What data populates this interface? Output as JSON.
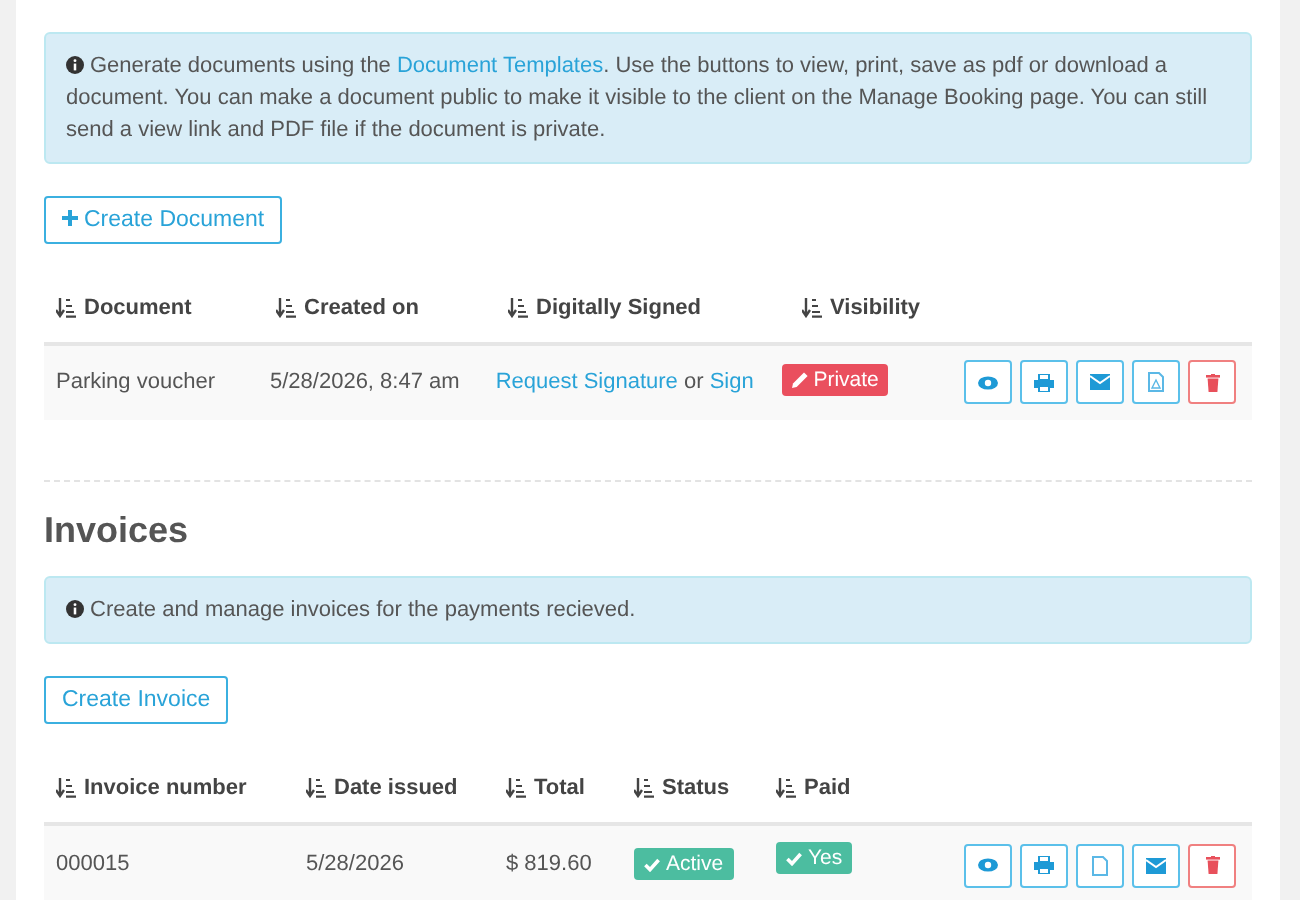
{
  "documents": {
    "info": {
      "before": "Generate documents using the ",
      "link": "Document Templates",
      "after": ". Use the buttons to view, print, save as pdf or download a document. You can make a document public to make it visible to the client on the Manage Booking page. You can still send a view link and PDF file if the document is private."
    },
    "create_button": "Create Document",
    "columns": [
      "Document",
      "Created on",
      "Digitally Signed",
      "Visibility"
    ],
    "rows": [
      {
        "cells": [
          "Parking voucher",
          "5/28/2026, 8:47 am"
        ],
        "signed": {
          "link": "Request Signature",
          "separator": "or",
          "second_link": "Sign"
        },
        "badge": {
          "label": "Private",
          "kind": "private"
        },
        "actions": [
          {
            "kind": "view"
          },
          {
            "kind": "print"
          },
          {
            "kind": "email"
          },
          {
            "kind": "pdf"
          },
          {
            "kind": "delete"
          }
        ]
      }
    ]
  },
  "invoices": {
    "heading": "Invoices",
    "info": "Create and manage invoices for the payments recieved.",
    "create_button": "Create Invoice",
    "columns": [
      "Invoice number",
      "Date issued",
      "Total",
      "Status",
      "Paid"
    ],
    "rows": [
      {
        "cells": [
          "000015",
          "5/28/2026",
          "$ 819.60"
        ],
        "status": {
          "label": "Active",
          "kind": "active"
        },
        "paid": {
          "label": "Yes",
          "kind": "yes"
        },
        "actions": [
          {
            "kind": "view"
          },
          {
            "kind": "print"
          },
          {
            "kind": "file"
          },
          {
            "kind": "email"
          },
          {
            "kind": "delete"
          }
        ]
      }
    ]
  }
}
